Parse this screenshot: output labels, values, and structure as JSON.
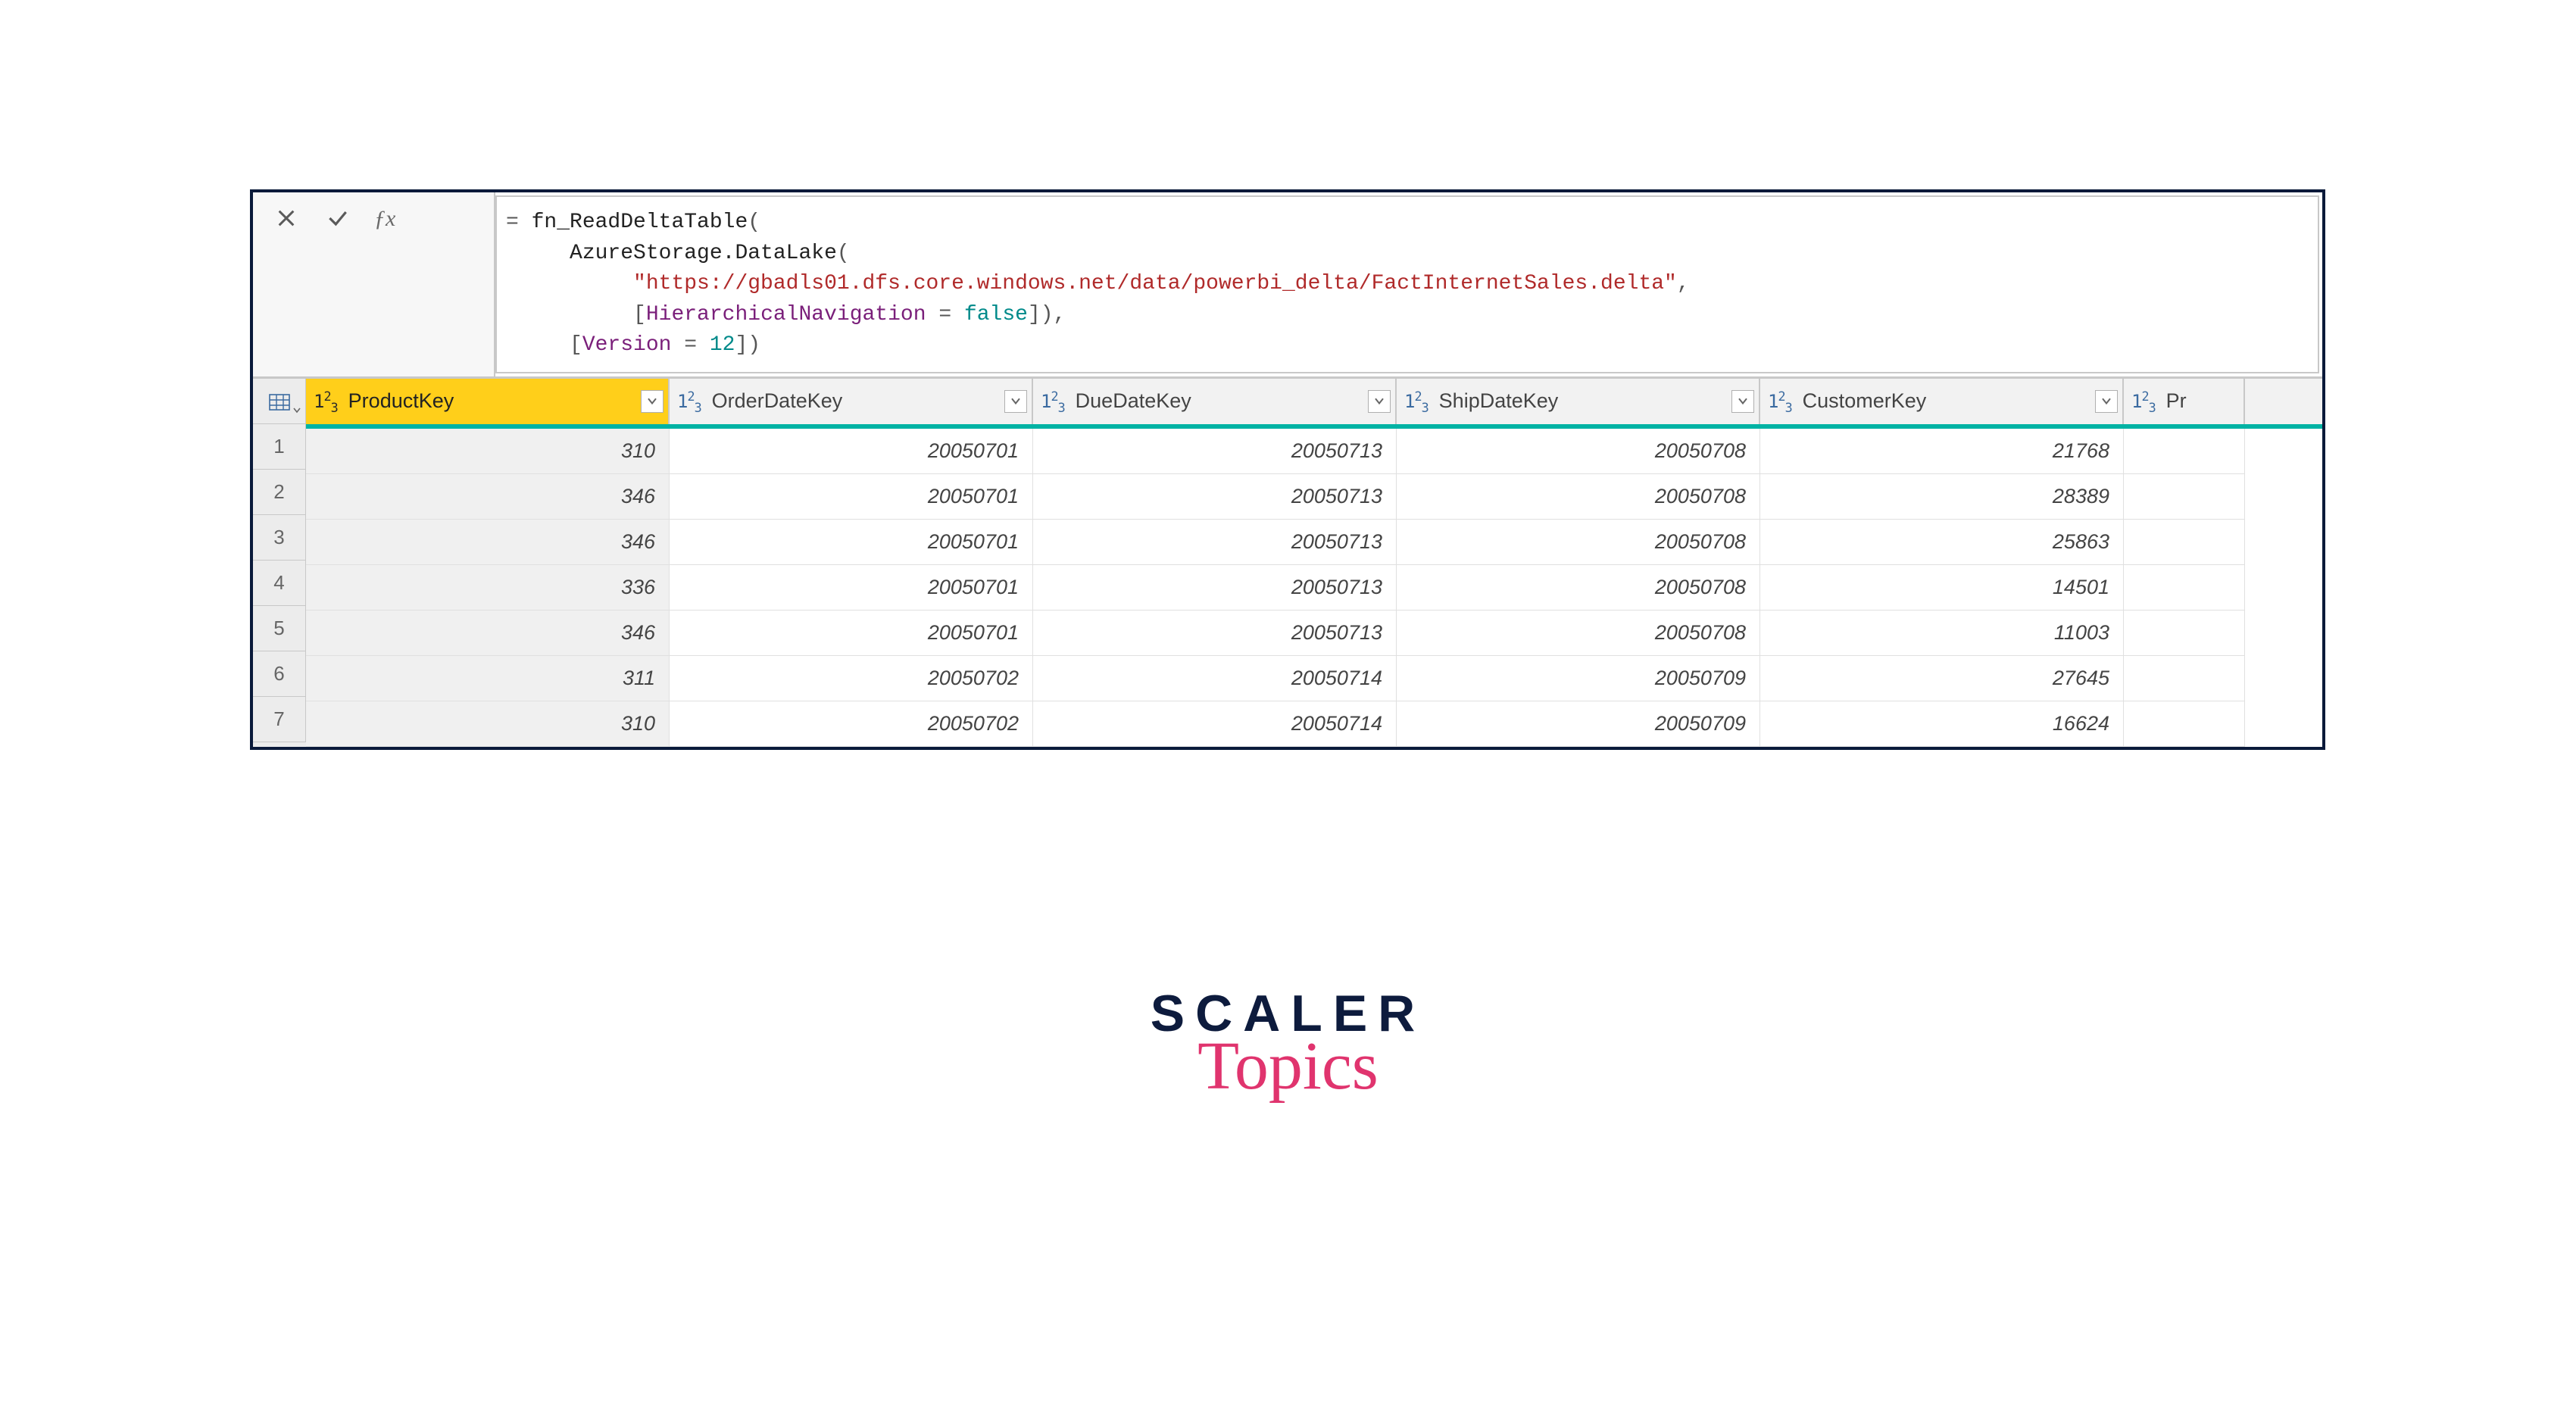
{
  "formula": {
    "prefix": "= ",
    "fn1": "fn_ReadDeltaTable",
    "line1_tail": "(",
    "indent1": "     ",
    "fn2": "AzureStorage.DataLake",
    "line2_tail": "(",
    "indent2": "          ",
    "url": "\"https://gbadls01.dfs.core.windows.net/data/powerbi_delta/FactInternetSales.delta\"",
    "line3_tail": ",",
    "indent3": "          ",
    "opt_open": "[",
    "opt_key1": "HierarchicalNavigation",
    "opt_eq": " = ",
    "opt_val1": "false",
    "opt_close": "]),",
    "indent4": "     ",
    "opt2_open": "[",
    "opt_key2": "Version",
    "opt2_eq": " = ",
    "opt_val2": "12",
    "opt2_close": "])"
  },
  "columns": [
    {
      "label": "ProductKey",
      "selected": true,
      "cls": "c-productkey"
    },
    {
      "label": "OrderDateKey",
      "selected": false,
      "cls": "c-orderdate"
    },
    {
      "label": "DueDateKey",
      "selected": false,
      "cls": "c-duedate"
    },
    {
      "label": "ShipDateKey",
      "selected": false,
      "cls": "c-shipdate"
    },
    {
      "label": "CustomerKey",
      "selected": false,
      "cls": "c-customer"
    },
    {
      "label": "Pr",
      "selected": false,
      "cls": "c-partial",
      "partial": true
    }
  ],
  "type_prefix": "1²₃",
  "rownums": [
    "1",
    "2",
    "3",
    "4",
    "5",
    "6",
    "7"
  ],
  "rows": [
    [
      "310",
      "20050701",
      "20050713",
      "20050708",
      "21768",
      ""
    ],
    [
      "346",
      "20050701",
      "20050713",
      "20050708",
      "28389",
      ""
    ],
    [
      "346",
      "20050701",
      "20050713",
      "20050708",
      "25863",
      ""
    ],
    [
      "336",
      "20050701",
      "20050713",
      "20050708",
      "14501",
      ""
    ],
    [
      "346",
      "20050701",
      "20050713",
      "20050708",
      "11003",
      ""
    ],
    [
      "311",
      "20050702",
      "20050714",
      "20050709",
      "27645",
      ""
    ],
    [
      "310",
      "20050702",
      "20050714",
      "20050709",
      "16624",
      ""
    ]
  ],
  "logo": {
    "line1": "SCALER",
    "line2": "Topics"
  }
}
